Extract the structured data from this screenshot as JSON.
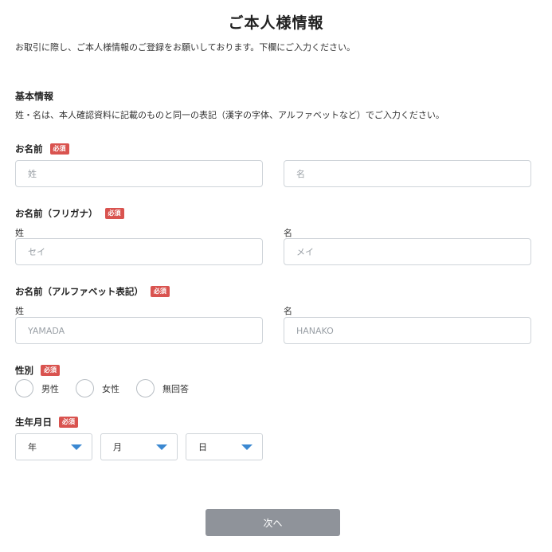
{
  "page": {
    "title": "ご本人様情報",
    "intro": "お取引に際し、ご本人様情報のご登録をお願いしております。下欄にご入力ください。"
  },
  "basic": {
    "title": "基本情報",
    "description": "姓・名は、本人確認資料に記載のものと同一の表記（漢字の字体、アルファベットなど）でご入力ください。"
  },
  "required_badge": "必須",
  "name": {
    "label": "お名前",
    "last_placeholder": "姓",
    "first_placeholder": "名"
  },
  "furigana": {
    "label": "お名前（フリガナ）",
    "last_label": "姓",
    "first_label": "名",
    "last_placeholder": "セイ",
    "first_placeholder": "メイ"
  },
  "alphabet": {
    "label": "お名前（アルファベット表記）",
    "last_label": "姓",
    "first_label": "名",
    "last_placeholder": "YAMADA",
    "first_placeholder": "HANAKO"
  },
  "gender": {
    "label": "性別",
    "options": [
      "男性",
      "女性",
      "無回答"
    ]
  },
  "birthdate": {
    "label": "生年月日",
    "year": "年",
    "month": "月",
    "day": "日"
  },
  "actions": {
    "next_label": "次へ"
  },
  "colors": {
    "badge": "#d9534f",
    "caret": "#3b88d1",
    "button": "#8f939a"
  }
}
